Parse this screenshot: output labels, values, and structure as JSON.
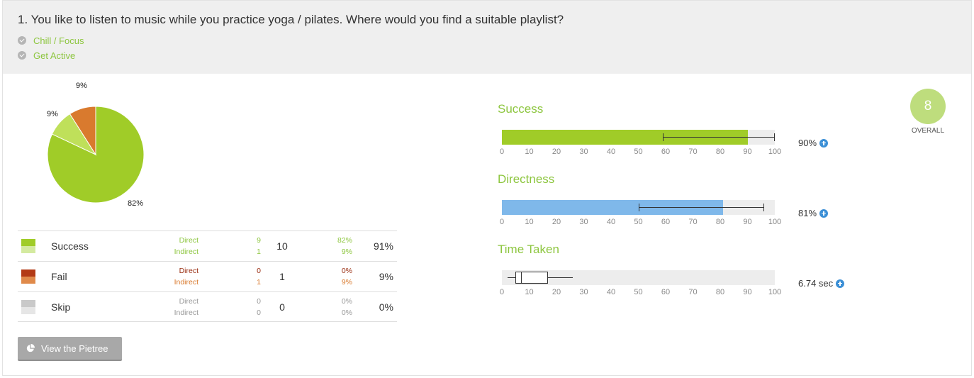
{
  "question": {
    "title": "1. You like to listen to music while you practice yoga / pilates. Where would you find a suitable playlist?",
    "answers": [
      "Chill / Focus",
      "Get Active"
    ]
  },
  "pie": {
    "slices": [
      {
        "label": "82%",
        "value": 82,
        "color": "#a0cc28"
      },
      {
        "label": "9%",
        "value": 9,
        "color": "#bfe05a"
      },
      {
        "label": "9%",
        "value": 9,
        "color": "#d97a2e"
      }
    ]
  },
  "results": [
    {
      "name": "Success",
      "colors": [
        "#a0cc28",
        "#d4eaa0"
      ],
      "sub_color": "#8dc63f",
      "direct_label": "Direct",
      "indirect_label": "Indirect",
      "direct": "9",
      "indirect": "1",
      "total": "10",
      "direct_pct": "82%",
      "indirect_pct": "9%",
      "total_pct": "91%"
    },
    {
      "name": "Fail",
      "colors": [
        "#b33a15",
        "#e08a4a"
      ],
      "sub_color": "#9a2e12",
      "sub_color2": "#d97a2e",
      "direct_label": "Direct",
      "indirect_label": "Indirect",
      "direct": "0",
      "indirect": "1",
      "total": "1",
      "direct_pct": "0%",
      "indirect_pct": "9%",
      "total_pct": "9%"
    },
    {
      "name": "Skip",
      "colors": [
        "#c9c9c9",
        "#e6e6e6"
      ],
      "sub_color": "#999999",
      "direct_label": "Direct",
      "indirect_label": "Indirect",
      "direct": "0",
      "indirect": "0",
      "total": "0",
      "direct_pct": "0%",
      "indirect_pct": "0%",
      "total_pct": "0%"
    }
  ],
  "pietree_button": {
    "label": "View the Pietree"
  },
  "axis_ticks": [
    "0",
    "10",
    "20",
    "30",
    "40",
    "50",
    "60",
    "70",
    "80",
    "90",
    "100"
  ],
  "metrics": {
    "success": {
      "title": "Success",
      "value": 90,
      "ci": [
        59,
        100
      ],
      "color": "#a0cc28",
      "display": "90%"
    },
    "directness": {
      "title": "Directness",
      "value": 81,
      "ci": [
        50,
        96
      ],
      "color": "#7fb8ea",
      "display": "81%"
    },
    "time_taken": {
      "title": "Time Taken",
      "whisker": [
        2,
        26
      ],
      "box": [
        5,
        17
      ],
      "median": 7,
      "display": "6.74 sec"
    }
  },
  "overall": {
    "score": "8",
    "label": "OVERALL"
  }
}
